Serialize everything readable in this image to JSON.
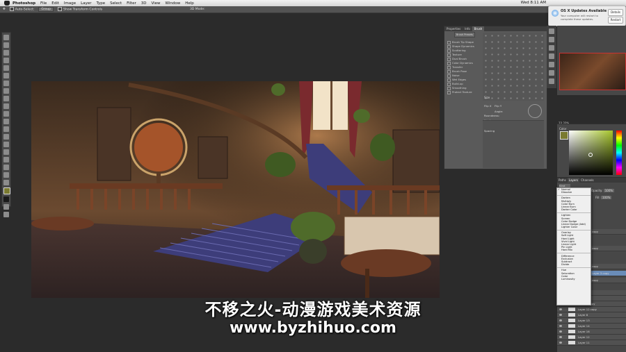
{
  "menubar": {
    "app": "Photoshop",
    "items": [
      "File",
      "Edit",
      "Image",
      "Layer",
      "Type",
      "Select",
      "Filter",
      "3D",
      "View",
      "Window",
      "Help"
    ],
    "clock": "Wed 8:11 AM"
  },
  "options_bar": {
    "auto_select": "Auto-Select:",
    "group": "Group",
    "show_transform": "Show Transform Controls",
    "mode_3d": "3D Mode:"
  },
  "notification": {
    "title": "OS X Updates Available",
    "body": "Your computer will restart to complete these updates.",
    "details": "Details",
    "restart": "Restart"
  },
  "brush_panel": {
    "tabs": [
      "Properties",
      "Info",
      "Brush"
    ],
    "preset_button": "Brush Presets",
    "options": [
      "Brush Tip Shape",
      "Shape Dynamics",
      "Scattering",
      "Texture",
      "Dual Brush",
      "Color Dynamics",
      "Transfer",
      "Brush Pose",
      "Noise",
      "Wet Edges",
      "Build-up",
      "Smoothing",
      "Protect Texture"
    ],
    "size_label": "Size",
    "angle_label": "Angle:",
    "roundness_label": "Roundness:",
    "hardness_label": "Hardness",
    "spacing_label": "Spacing",
    "flip_x": "Flip X",
    "flip_y": "Flip Y"
  },
  "navigator": {
    "zoom": "33.33%"
  },
  "color_panel": {
    "label": "Color",
    "fg_color": "#7a7a30"
  },
  "layers_panel": {
    "tabs": [
      "Paths",
      "Layers",
      "Channels"
    ],
    "kind_filter": "Kind",
    "opacity_label": "Opacity:",
    "opacity_value": "100%",
    "fill_label": "Fill:",
    "fill_value": "100%",
    "rows": [
      "copy",
      "copy",
      "copy",
      "Layer 3 copy",
      "copy",
      "Layer 3",
      "Layer 9",
      "Layer 9 copy",
      "Layer 12 copy",
      "Layer 8",
      "Layer 13",
      "Layer 14",
      "Layer 16",
      "Layer 12",
      "Layer 11"
    ]
  },
  "blend_menu": {
    "groups": [
      [
        "Normal",
        "Dissolve"
      ],
      [
        "Darken",
        "Multiply",
        "Color Burn",
        "Linear Burn",
        "Darker Color"
      ],
      [
        "Lighten",
        "Screen",
        "Color Dodge",
        "Linear Dodge (Add)",
        "Lighter Color"
      ],
      [
        "Overlay",
        "Soft Light",
        "Hard Light",
        "Vivid Light",
        "Linear Light",
        "Pin Light",
        "Hard Mix"
      ],
      [
        "Difference",
        "Exclusion",
        "Subtract",
        "Divide"
      ],
      [
        "Hue",
        "Saturation",
        "Color",
        "Luminosity"
      ]
    ],
    "selected": "Normal"
  },
  "watermark": {
    "line1": "不移之火-动漫游戏美术资源",
    "line2": "www.byzhihuo.com"
  }
}
